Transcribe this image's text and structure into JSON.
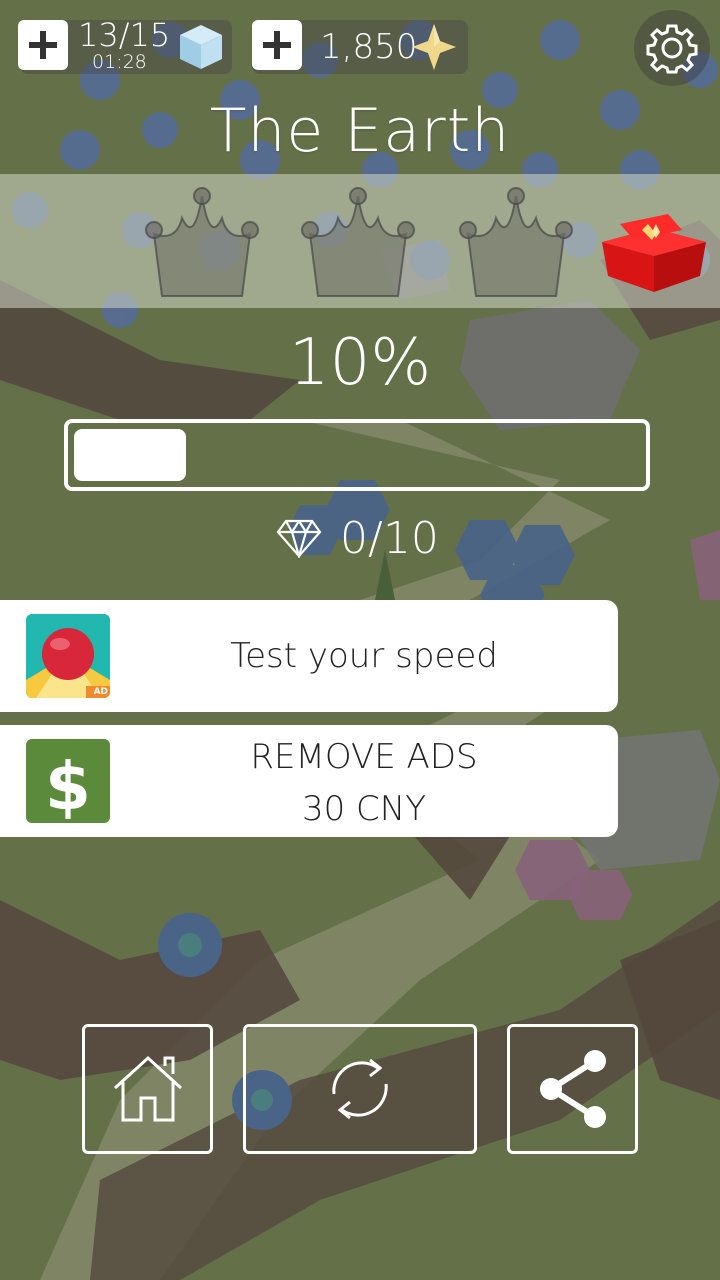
{
  "hud": {
    "energy_count": "13/15",
    "energy_timer": "01:28",
    "coins": "1,850"
  },
  "level": {
    "title": "The Earth",
    "crowns_earned": 0,
    "crowns_total": 3,
    "progress_label": "10%",
    "progress_value": 0.1,
    "gems": "0/10"
  },
  "offers": {
    "ad_label": "Test your speed",
    "ad_badge": "AD",
    "remove_ads_title": "REMOVE ADS",
    "remove_ads_price": "30 CNY"
  },
  "icons": {
    "energy_add": "plus-icon",
    "energy_cube": "cube-icon",
    "coins_add": "plus-icon",
    "coin_star": "star-icon",
    "settings": "gear-icon",
    "crown": "crown-icon",
    "gift": "gift-box-icon",
    "gem": "diamond-icon",
    "ad_game": "ball-game-icon",
    "remove_ads": "dollar-icon",
    "home": "home-icon",
    "restart": "restart-icon",
    "share": "share-icon"
  },
  "colors": {
    "grass": "#6b7a4a",
    "ribbon": "#e0f0ea",
    "gift_red": "#e01818",
    "ad_ball": "#d8263a",
    "ad_bg_teal": "#22b8b0",
    "ad_bg_yellow": "#f6c93e",
    "dollar_green": "#5a8a3a"
  }
}
